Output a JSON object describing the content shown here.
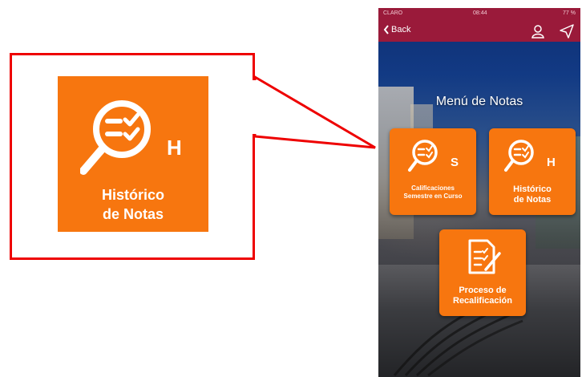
{
  "callout": {
    "tile_label_line1": "Histórico",
    "tile_label_line2": "de Notas",
    "tile_badge": "H"
  },
  "phone": {
    "status_bar": {
      "carrier": "CLARO",
      "time": "08:44",
      "battery": "77 %"
    },
    "nav_bar": {
      "back_label": "Back",
      "icons": [
        "user-icon",
        "send-icon"
      ]
    },
    "menu_title": "Menú de Notas",
    "tiles": [
      {
        "badge": "S",
        "label_line1": "Calificaciones",
        "label_line2": "Semestre en Curso"
      },
      {
        "badge": "H",
        "label_line1": "Histórico",
        "label_line2": "de Notas"
      },
      {
        "label_line1": "Proceso de",
        "label_line2": "Recalificación"
      }
    ]
  },
  "colors": {
    "accent_orange": "#f7760f",
    "header_maroon": "#9a1a3a",
    "callout_red": "#ee0000"
  }
}
